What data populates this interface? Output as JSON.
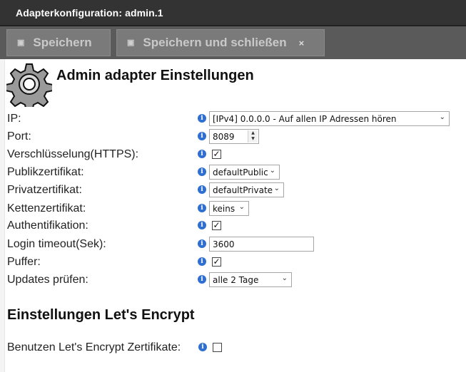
{
  "title": "Adapterkonfiguration: admin.1",
  "toolbar": {
    "save_label": "Speichern",
    "save_close_label": "Speichern und schließen",
    "close_glyph": "×",
    "save_icon": "floppy-disk-icon"
  },
  "section1": {
    "heading": "Admin adapter Einstellungen",
    "icon": "gear-icon"
  },
  "fields": {
    "ip": {
      "label": "IP:",
      "value": "[IPv4] 0.0.0.0 - Auf allen IP Adressen hören"
    },
    "port": {
      "label": "Port:",
      "value": "8089"
    },
    "https": {
      "label": "Verschlüsselung(HTTPS):",
      "checked": true
    },
    "public_cert": {
      "label": "Publikzertifikat:",
      "value": "defaultPublic"
    },
    "private_cert": {
      "label": "Privatzertifikat:",
      "value": "defaultPrivate"
    },
    "chain_cert": {
      "label": "Kettenzertifikat:",
      "value": "keins"
    },
    "auth": {
      "label": "Authentifikation:",
      "checked": true
    },
    "login_timeout": {
      "label": "Login timeout(Sek):",
      "value": "3600"
    },
    "buffer": {
      "label": "Puffer:",
      "checked": true
    },
    "updates": {
      "label": "Updates prüfen:",
      "value": "alle 2 Tage"
    }
  },
  "section2": {
    "heading": "Einstellungen Let's Encrypt"
  },
  "letsencrypt": {
    "label": "Benutzen Let's Encrypt Zertifikate:",
    "checked": false
  },
  "info_glyph": "i",
  "check_glyph": "✓",
  "colors": {
    "titlebar": "#333333",
    "toolbar": "#5a5a5a",
    "info": "#2f6fd1"
  }
}
